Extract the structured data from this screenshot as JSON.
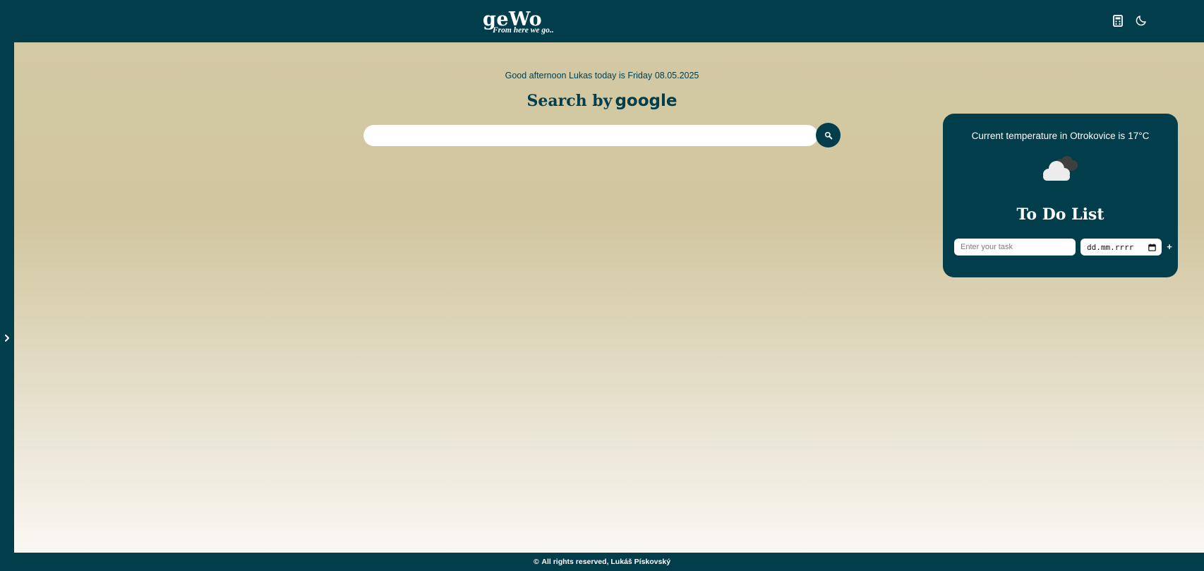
{
  "header": {
    "logo_title": "geWo",
    "logo_tagline": "From here we go..",
    "icons": [
      "calculator-icon",
      "moon-icon"
    ]
  },
  "sidebar": {
    "toggle_icon": "chevron-right-icon"
  },
  "main": {
    "greeting": "Good afternoon Lukas today is Friday",
    "date": "08.05.2025",
    "search_title_prefix": "Search by",
    "search_title_brand": "google",
    "search_input_value": "",
    "search_button_icon": "search-icon"
  },
  "weather": {
    "text": "Current temperature in Otrokovice is",
    "temperature": "17°C",
    "icon": "cloud-icon"
  },
  "todo": {
    "title": "To Do List",
    "task_placeholder": "Enter your task",
    "date_placeholder": "dd.mm.rrrr",
    "add_label": "+"
  },
  "footer": {
    "symbol": "©",
    "text": "All rights reserved, Lukáš Pískovský"
  },
  "colors": {
    "primary": "#023d4c",
    "background_top": "#d3c9a4",
    "background_bottom": "#fbf7f3",
    "cloud_front": "#ececec",
    "cloud_back": "#3f3f3f"
  }
}
